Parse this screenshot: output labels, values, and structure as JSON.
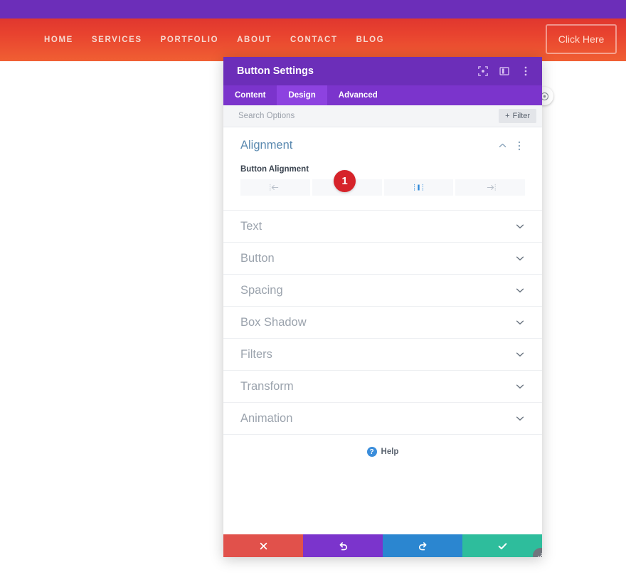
{
  "site": {
    "nav_items": [
      {
        "label": "HOME"
      },
      {
        "label": "SERVICES"
      },
      {
        "label": "PORTFOLIO"
      },
      {
        "label": "ABOUT"
      },
      {
        "label": "CONTACT"
      },
      {
        "label": "BLOG"
      }
    ],
    "cta_label": "Click Here",
    "gradient_top": "#e0372f",
    "gradient_bottom": "#f05f33",
    "top_strip_color": "#6c2eb9"
  },
  "modal": {
    "title": "Button Settings",
    "titlebar_color": "#6c2eb9",
    "title_icons": [
      {
        "name": "focus-target-icon"
      },
      {
        "name": "layout-panel-icon"
      },
      {
        "name": "more-vertical-icon"
      }
    ],
    "tabs": [
      {
        "label": "Content",
        "active": false
      },
      {
        "label": "Design",
        "active": true
      },
      {
        "label": "Advanced",
        "active": false
      }
    ],
    "search": {
      "placeholder": "Search Options",
      "value": "",
      "filter_label": "Filter",
      "filter_plus": "+"
    },
    "alignment_section": {
      "title": "Alignment",
      "expanded": true,
      "field_label": "Button Alignment",
      "badge": "1",
      "badge_color": "#d6232a",
      "options": [
        {
          "name": "align-left-icon",
          "selected": false
        },
        {
          "name": "align-hidden-icon",
          "selected": false
        },
        {
          "name": "align-center-icon",
          "selected": true
        },
        {
          "name": "align-right-icon",
          "selected": false
        }
      ]
    },
    "collapsed_sections": [
      {
        "label": "Text"
      },
      {
        "label": "Button"
      },
      {
        "label": "Spacing"
      },
      {
        "label": "Box Shadow"
      },
      {
        "label": "Filters"
      },
      {
        "label": "Transform"
      },
      {
        "label": "Animation"
      }
    ],
    "help": {
      "label": "Help",
      "icon_char": "?"
    },
    "footer_buttons": [
      {
        "name": "cancel-button",
        "icon": "close-icon",
        "color": "#e1514b"
      },
      {
        "name": "undo-button",
        "icon": "undo-icon",
        "color": "#7b34cc"
      },
      {
        "name": "redo-button",
        "icon": "redo-icon",
        "color": "#2b86d0"
      },
      {
        "name": "save-button",
        "icon": "check-icon",
        "color": "#2ebd9c"
      }
    ]
  }
}
